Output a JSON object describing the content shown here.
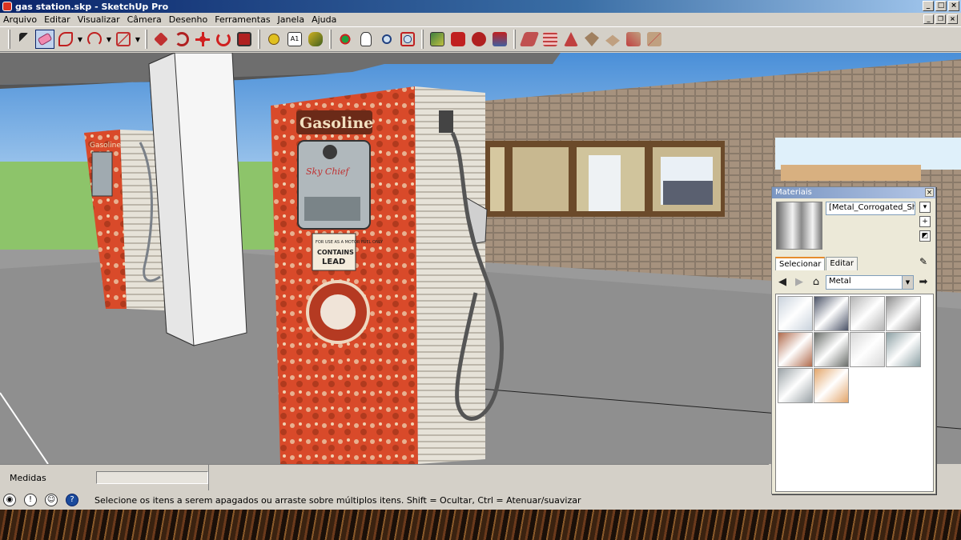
{
  "window": {
    "title": "gas station.skp - SketchUp Pro"
  },
  "menu": [
    "Arquivo",
    "Editar",
    "Visualizar",
    "Câmera",
    "Desenho",
    "Ferramentas",
    "Janela",
    "Ajuda"
  ],
  "scene": {
    "pump_sign": "Gasoline",
    "pump_brand": "Sky Chief",
    "pump_label_small": "FOR USE AS A MOTOR FUEL ONLY",
    "pump_label_big1": "CONTAINS",
    "pump_label_big2": "LEAD",
    "far_pump_sign": "Gasoline"
  },
  "materials": {
    "title": "Materiais",
    "current_name": "[Metal_Corrogated_Shiny]",
    "tabs": [
      "Selecionar",
      "Editar"
    ],
    "library": "Metal",
    "swatch_colors": [
      "#c9d2dc",
      "#4a5266",
      "#b4b4b4",
      "#8c8c8c",
      "#b06a4c",
      "#6a6e6a",
      "#d8d8d8",
      "#8ca0a4",
      "#9aa2a6",
      "#e3a66b"
    ]
  },
  "status": {
    "measurements_label": "Medidas",
    "hint": "Selecione os itens a serem apagados ou arraste sobre múltiplos itens. Shift = Ocultar, Ctrl = Atenuar/suavizar"
  }
}
